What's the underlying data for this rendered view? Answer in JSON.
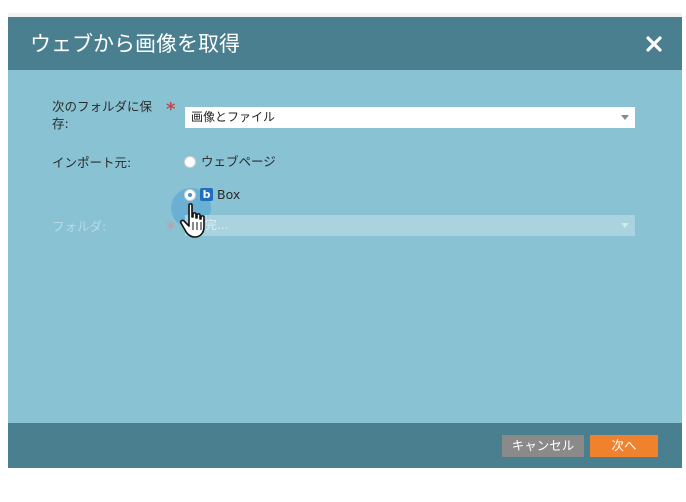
{
  "dialog": {
    "title": "ウェブから画像を取得",
    "close_icon": "close-x-icon"
  },
  "form": {
    "save_to_label": "次のフォルダに保存:",
    "save_to_value": "画像とファイル",
    "import_source_label": "インポート元:",
    "source_options": [
      {
        "label": "ウェブページ",
        "checked": false
      },
      {
        "label": "Box",
        "checked": true,
        "icon": "box-logo-icon"
      }
    ],
    "folder_label": "フォルダ:",
    "folder_value": "完..."
  },
  "footer": {
    "cancel_label": "キャンセル",
    "next_label": "次へ"
  },
  "colors": {
    "titlebar": "#4a7f8f",
    "body": "#89c3d3",
    "next_button": "#f0822d",
    "cancel_button": "#8a8a8a",
    "required_star": "#c0484b"
  }
}
